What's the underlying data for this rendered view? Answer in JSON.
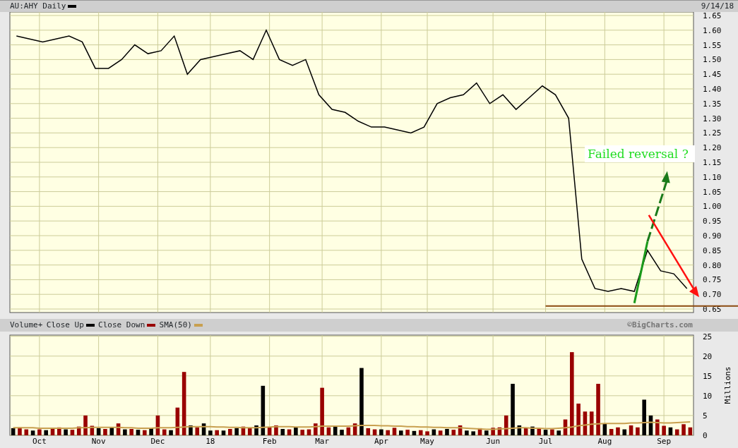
{
  "header": {
    "date": "9/14/18"
  },
  "price_chart": {
    "chart_data": {
      "type": "line",
      "categories": [
        null,
        null,
        null,
        null,
        null,
        null,
        null,
        null,
        null,
        null,
        null,
        null,
        null,
        null,
        null,
        null,
        null,
        null,
        null,
        null,
        null,
        null,
        null,
        null,
        null,
        null,
        null,
        null,
        null,
        null,
        null,
        null,
        null,
        null,
        null,
        null,
        null,
        null,
        null,
        null,
        null,
        null,
        null,
        null,
        null,
        null,
        null,
        null,
        null,
        null,
        null,
        null
      ],
      "series": [
        {
          "name": "AU:AHY Daily",
          "color": "#000000",
          "values": [
            1.58,
            1.57,
            1.56,
            1.57,
            1.58,
            1.56,
            1.47,
            1.47,
            1.5,
            1.55,
            1.52,
            1.53,
            1.58,
            1.45,
            1.5,
            1.51,
            1.52,
            1.53,
            1.5,
            1.6,
            1.5,
            1.48,
            1.5,
            1.38,
            1.33,
            1.32,
            1.29,
            1.27,
            1.27,
            1.26,
            1.25,
            1.27,
            1.35,
            1.37,
            1.38,
            1.42,
            1.35,
            1.38,
            1.33,
            1.37,
            1.41,
            1.38,
            1.3,
            0.82,
            0.72,
            0.71,
            0.72,
            0.71,
            0.85,
            0.78,
            0.77,
            0.72
          ]
        }
      ],
      "ylim": [
        0.638,
        1.662
      ],
      "grid": true,
      "ref_lines": [
        {
          "axis": "y",
          "value": 0.66,
          "color": "#8b4a10"
        }
      ],
      "yticks": [
        {
          "value": 0.65,
          "label": "0.65"
        },
        {
          "value": 0.7,
          "label": "0.70"
        },
        {
          "value": 0.75,
          "label": "0.75"
        },
        {
          "value": 0.8,
          "label": "0.80"
        },
        {
          "value": 0.85,
          "label": "0.85"
        },
        {
          "value": 0.9,
          "label": "0.90"
        },
        {
          "value": 0.95,
          "label": "0.95"
        },
        {
          "value": 1.0,
          "label": "1.00"
        },
        {
          "value": 1.05,
          "label": "1.05"
        },
        {
          "value": 1.1,
          "label": "1.10"
        },
        {
          "value": 1.15,
          "label": "1.15"
        },
        {
          "value": 1.2,
          "label": "1.20"
        },
        {
          "value": 1.25,
          "label": "1.25"
        },
        {
          "value": 1.3,
          "label": "1.30"
        },
        {
          "value": 1.35,
          "label": "1.35"
        },
        {
          "value": 1.4,
          "label": "1.40"
        },
        {
          "value": 1.45,
          "label": "1.45"
        },
        {
          "value": 1.5,
          "label": "1.50"
        },
        {
          "value": 1.55,
          "label": "1.55"
        },
        {
          "value": 1.6,
          "label": "1.60"
        },
        {
          "value": 1.65,
          "label": "1.65"
        }
      ],
      "annotations": [
        {
          "text": "Failed reversal ?"
        }
      ]
    }
  },
  "volume_chart": {
    "credit": "©BigCharts.com",
    "chart_data": {
      "type": "bar",
      "title": "Volume+",
      "ylabel": "Millions",
      "categories": [
        null,
        null,
        null,
        null,
        "Oct",
        null,
        null,
        null,
        null,
        null,
        null,
        null,
        null,
        "Nov",
        null,
        null,
        null,
        null,
        null,
        null,
        null,
        null,
        "Dec",
        null,
        null,
        null,
        null,
        null,
        null,
        null,
        "18",
        null,
        null,
        null,
        null,
        null,
        null,
        null,
        null,
        "Feb",
        null,
        null,
        null,
        null,
        null,
        null,
        null,
        "Mar",
        null,
        null,
        null,
        null,
        null,
        null,
        null,
        null,
        "Apr",
        null,
        null,
        null,
        null,
        null,
        null,
        "May",
        null,
        null,
        null,
        null,
        null,
        null,
        null,
        null,
        null,
        "Jun",
        null,
        null,
        null,
        null,
        null,
        null,
        null,
        "Jul",
        null,
        null,
        null,
        null,
        null,
        null,
        null,
        null,
        "Aug",
        null,
        null,
        null,
        null,
        null,
        null,
        null,
        null,
        "Sep",
        null,
        null,
        null,
        null
      ],
      "series": [
        {
          "name": "Close Up",
          "color": "#000000",
          "values": [
            1.8,
            null,
            null,
            1.2,
            null,
            1.3,
            null,
            null,
            1.5,
            null,
            null,
            null,
            null,
            1.8,
            null,
            2,
            null,
            1.5,
            null,
            1.4,
            null,
            1.8,
            null,
            null,
            1.3,
            null,
            null,
            2.5,
            null,
            3,
            1.2,
            null,
            1.2,
            null,
            1.8,
            null,
            null,
            2.5,
            12.5,
            null,
            null,
            1.6,
            null,
            2,
            null,
            null,
            null,
            null,
            null,
            2.2,
            1.4,
            null,
            null,
            17,
            null,
            null,
            1.5,
            null,
            null,
            1.2,
            null,
            1.1,
            null,
            null,
            1.5,
            null,
            1.6,
            null,
            null,
            1.2,
            1,
            null,
            1.2,
            null,
            null,
            null,
            13,
            2.5,
            null,
            2.2,
            null,
            1.4,
            null,
            1.2,
            null,
            null,
            null,
            null,
            null,
            null,
            3,
            null,
            null,
            1.5,
            null,
            null,
            9,
            5,
            null,
            null,
            2,
            null,
            null,
            null
          ]
        },
        {
          "name": "Close Down",
          "color": "#990000",
          "values": [
            null,
            2,
            1.5,
            null,
            1.5,
            null,
            1.6,
            2,
            null,
            1.4,
            2.2,
            5,
            2.4,
            null,
            1.6,
            null,
            3,
            null,
            1.6,
            null,
            1.3,
            null,
            5,
            1.5,
            null,
            7,
            16,
            null,
            2,
            null,
            null,
            1.3,
            null,
            1.6,
            null,
            2.2,
            1.8,
            null,
            null,
            2,
            2.5,
            null,
            1.5,
            null,
            1.4,
            1.5,
            3,
            12,
            2,
            null,
            null,
            2,
            3,
            null,
            1.8,
            1.5,
            null,
            1.3,
            1.9,
            null,
            1.4,
            null,
            1.3,
            1,
            null,
            1.2,
            null,
            1.4,
            2.5,
            null,
            null,
            1.8,
            null,
            1.9,
            2,
            5,
            null,
            null,
            1.8,
            null,
            1.6,
            null,
            1.5,
            null,
            4,
            21,
            8,
            6,
            6,
            13,
            null,
            1.6,
            2,
            null,
            2.5,
            2,
            null,
            null,
            4,
            2.4,
            null,
            1.5,
            2.8,
            2
          ]
        },
        {
          "name": "SMA(50)",
          "type": "line",
          "color": "#c8a050",
          "values": [
            1.9,
            1.9,
            1.9,
            1.9,
            1.8,
            1.8,
            1.8,
            1.8,
            1.8,
            1.8,
            1.9,
            1.9,
            2,
            2,
            2,
            2,
            2,
            1.9,
            1.9,
            1.8,
            1.8,
            1.8,
            1.9,
            1.9,
            1.9,
            2,
            2.1,
            2.2,
            2.2,
            2.2,
            2.2,
            2.1,
            2.1,
            2,
            2,
            1.9,
            1.9,
            1.9,
            2,
            2.1,
            2.2,
            2.2,
            2.2,
            2.1,
            2.1,
            2.1,
            2.2,
            2.3,
            2.3,
            2.3,
            2.3,
            2.3,
            2.4,
            2.5,
            2.5,
            2.5,
            2.4,
            2.4,
            2.3,
            2.3,
            2.2,
            2.2,
            2.1,
            2.1,
            2,
            2,
            1.9,
            1.9,
            1.9,
            1.8,
            1.7,
            1.6,
            1.5,
            1.5,
            1.6,
            1.7,
            1.8,
            1.9,
            1.9,
            1.8,
            1.8,
            1.7,
            1.7,
            1.8,
            1.9,
            2.1,
            2.4,
            2.6,
            2.8,
            2.9,
            3,
            3,
            3,
            3,
            3.1,
            3.1,
            3.2,
            3.3,
            3.2,
            3.1,
            3.1,
            3.2,
            3.3,
            3.4
          ]
        }
      ],
      "ylim": [
        0,
        25.3
      ],
      "grid": true,
      "yticks": [
        0,
        5,
        10,
        15,
        20,
        25
      ]
    }
  }
}
